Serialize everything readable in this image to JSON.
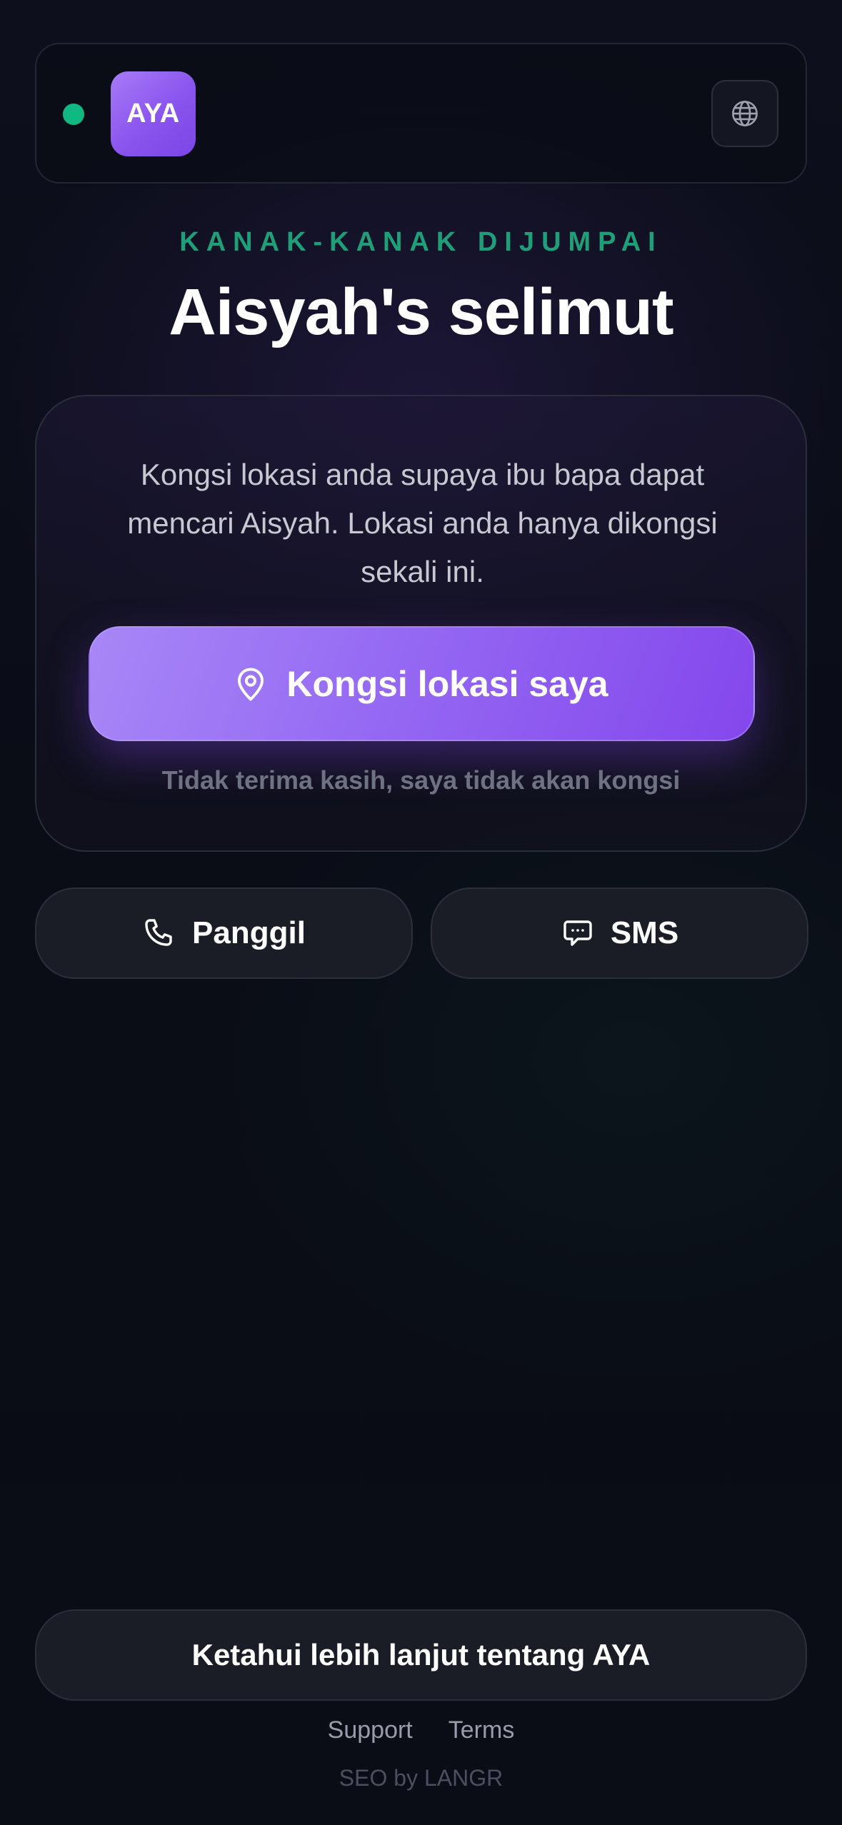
{
  "header": {
    "logo_text": "AYA",
    "status_color": "#10b981",
    "language_icon": "globe-icon"
  },
  "heading": {
    "eyebrow": "KANAK-KANAK DIJUMPAI",
    "title": "Aisyah's selimut"
  },
  "card": {
    "description": "Kongsi lokasi anda supaya ibu bapa dapat mencari Aisyah. Lokasi anda hanya dikongsi sekali ini.",
    "share_button_label": "Kongsi lokasi saya",
    "share_button_icon": "map-pin-icon",
    "decline_label": "Tidak terima kasih, saya tidak akan kongsi"
  },
  "contact": {
    "call_label": "Panggil",
    "call_icon": "phone-icon",
    "sms_label": "SMS",
    "sms_icon": "chat-bubble-icon"
  },
  "footer": {
    "learn_more_label": "Ketahui lebih lanjut tentang AYA",
    "links": [
      "Support",
      "Terms"
    ],
    "credit": "SEO by LANGR"
  },
  "colors": {
    "accent_purple": "#8a54ee",
    "eyebrow_green": "#1f9f78",
    "background": "#0b0d17"
  }
}
